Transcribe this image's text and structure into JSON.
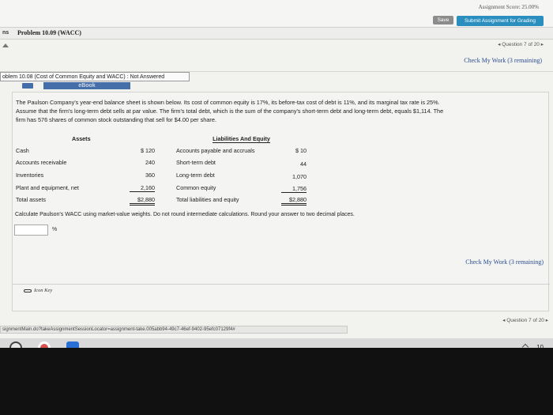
{
  "header": {
    "score": "Assignment Score: 25.00%",
    "save": "Save",
    "submit": "Submit Assignment for Grading"
  },
  "problem_bar": {
    "prefix": "ns",
    "title": "Problem 10.09 (WACC)"
  },
  "nav": {
    "question_top": "◂ Question 7 of 20 ▸",
    "question_bottom": "◂ Question 7 of 20 ▸",
    "check_work": "Check My Work (3 remaining)"
  },
  "problem": {
    "status": "oblem 10.08 (Cost of Common Equity and WACC) : Not Answered",
    "ebook": "eBook",
    "line1": "The Paulson Company's year-end balance sheet is shown below. Its cost of common equity is 17%, its before-tax cost of debt is 11%, and its marginal tax rate is 25%.",
    "line2": "Assume that the firm's long-term debt sells at par value. The firm's total debt, which is the sum of the company's short-term debt and long-term debt, equals $1,114. The",
    "line3": "firm has 576 shares of common stock outstanding that sell for $4.00 per share.",
    "question": "Calculate Paulson's WACC using market-value weights. Do not round intermediate calculations. Round your answer to two decimal places.",
    "answer_value": "",
    "unit": "%"
  },
  "balance_sheet": {
    "assets_header": "Assets",
    "liab_header": "Liabilities And Equity",
    "assets": [
      {
        "label": "Cash",
        "value": "$ 120"
      },
      {
        "label": "Accounts receivable",
        "value": "240"
      },
      {
        "label": "Inventories",
        "value": "360"
      },
      {
        "label": "Plant and equipment, net",
        "value": "2,160"
      },
      {
        "label": "Total assets",
        "value": "$2,880"
      }
    ],
    "liabilities": [
      {
        "label": "Accounts payable and accruals",
        "value": "$ 10"
      },
      {
        "label": "Short-term debt",
        "value": "44"
      },
      {
        "label": "Long-term debt",
        "value": "1,070"
      },
      {
        "label": "Common equity",
        "value": "1,756"
      },
      {
        "label": "Total liabilities and equity",
        "value": "$2,880"
      }
    ]
  },
  "footer": {
    "icon_key": "Icon Key",
    "status_url": "signmentMain.do?takeAssignmentSessionLocator=assignment-take.005abb94-49c7-46ef-9402-95efc07129f4#",
    "wifi": "10"
  }
}
